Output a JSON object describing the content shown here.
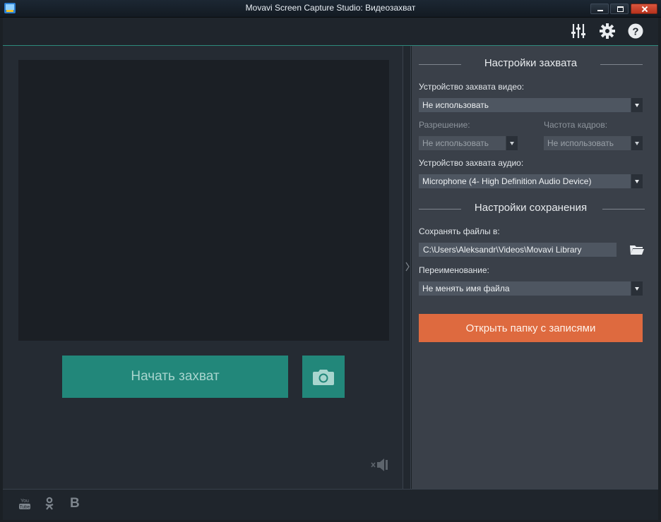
{
  "window": {
    "title": "Movavi Screen Capture Studio: Видеозахват"
  },
  "toolbar": {
    "icons": [
      "equalizer-icon",
      "gear-icon",
      "help-icon"
    ]
  },
  "capture": {
    "start_label": "Начать захват",
    "snapshot_icon": "camera-icon",
    "mute_icon": "speaker-muted-icon"
  },
  "capture_settings": {
    "title": "Настройки захвата",
    "video_device_label": "Устройство захвата видео:",
    "video_device_value": "Не использовать",
    "resolution_label": "Разрешение:",
    "resolution_value": "Не использовать",
    "framerate_label": "Частота кадров:",
    "framerate_value": "Не использовать",
    "audio_device_label": "Устройство захвата аудио:",
    "audio_device_value": "Microphone (4- High Definition Audio Device)"
  },
  "save_settings": {
    "title": "Настройки сохранения",
    "folder_label": "Сохранять файлы в:",
    "folder_value": "C:\\Users\\Aleksandr\\Videos\\Movavi Library",
    "rename_label": "Переименование:",
    "rename_value": "Не менять имя файла",
    "open_folder_label": "Открыть папку с записями"
  },
  "social": {
    "youtube_top": "You",
    "youtube_bottom": "Tube",
    "vk_letter": "B"
  },
  "colors": {
    "accent_green": "#22877a",
    "accent_orange": "#de6a3f",
    "close_red": "#c9422a"
  }
}
